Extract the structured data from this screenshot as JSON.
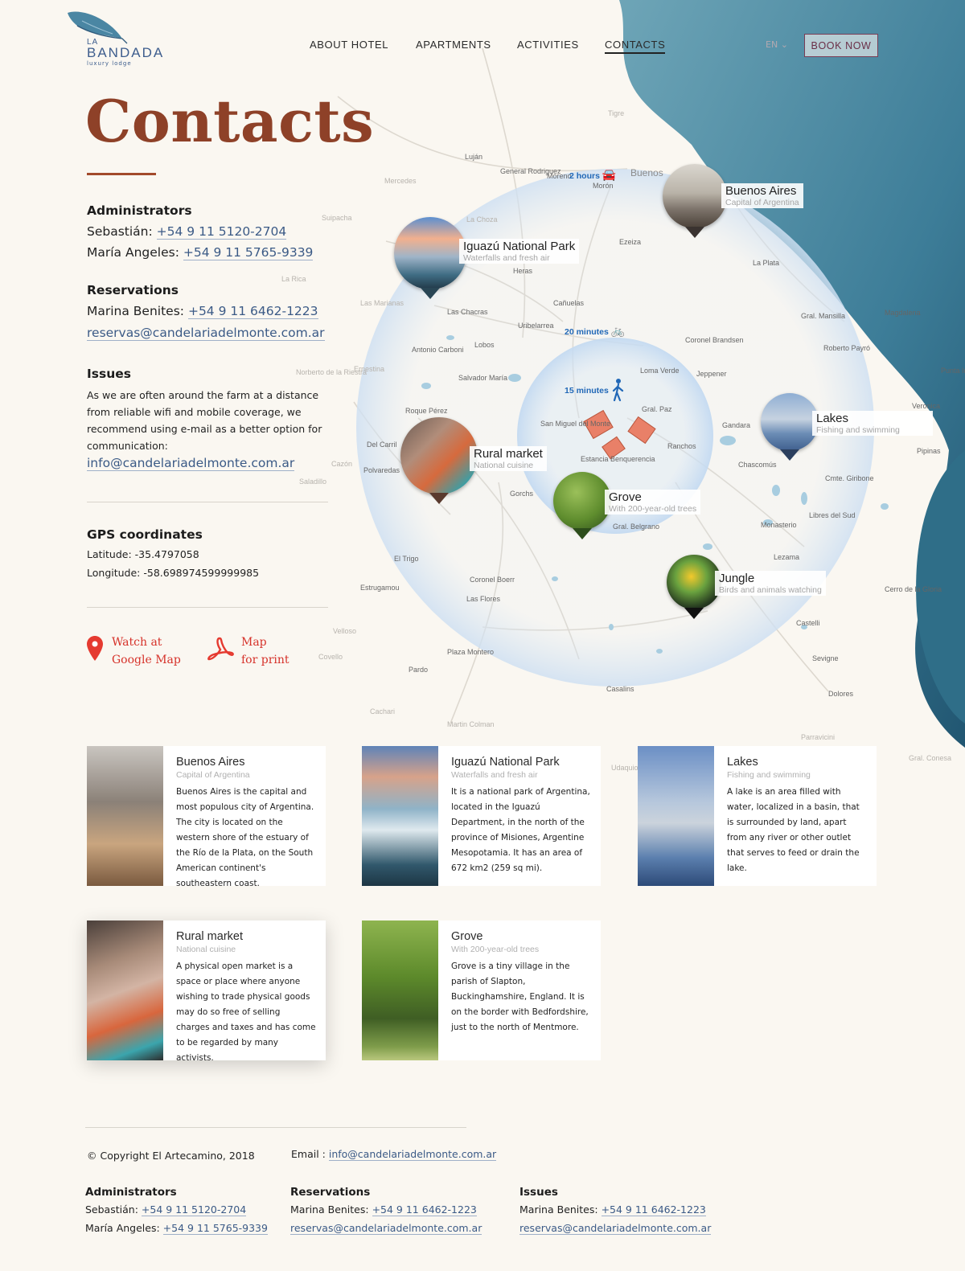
{
  "brand": {
    "name": "BANDADA",
    "prefix": "LA",
    "tagline": "luxury lodge"
  },
  "nav": {
    "items": [
      "ABOUT HOTEL",
      "APARTMENTS",
      "ACTIVITIES",
      "CONTACTS"
    ],
    "active": "CONTACTS",
    "lang": "EN",
    "book_label": "BOOK NOW"
  },
  "page": {
    "title": "Contacts"
  },
  "administrators": {
    "heading": "Administrators",
    "contacts": [
      {
        "name": "Sebastián:",
        "phone": "+54 9 11 5120-2704"
      },
      {
        "name": "María Angeles:",
        "phone": "+54 9 11 5765-9339"
      }
    ]
  },
  "reservations": {
    "heading": "Reservations",
    "name": "Marina Benites:",
    "phone": "+54 9 11 6462-1223",
    "email": "reservas@candelariadelmonte.com.ar"
  },
  "issues": {
    "heading": "Issues",
    "text": "As we are often around the farm at a distance from reliable wifi and mobile coverage, we recommend using e-mail as a better option for communication:",
    "email": "info@candelariadelmonte.com.ar"
  },
  "gps": {
    "heading": "GPS coordinates",
    "latitude_label": "Latitude:",
    "latitude": "-35.4797058",
    "longitude_label": "Longitude:",
    "longitude": "-58.698974599999985"
  },
  "links": {
    "google_line1": "Watch at",
    "google_line2": "Google Map",
    "print_line1": "Map",
    "print_line2": "for print"
  },
  "map": {
    "times": {
      "car": "2 hours",
      "bike": "20 minutes",
      "walk": "15 minutes"
    },
    "pins": [
      {
        "title": "Buenos Aires",
        "subtitle": "Capital of Argentina"
      },
      {
        "title": "Iguazú National Park",
        "subtitle": "Waterfalls and fresh air"
      },
      {
        "title": "Lakes",
        "subtitle": "Fishing and swimming"
      },
      {
        "title": "Rural market",
        "subtitle": "National cuisine"
      },
      {
        "title": "Grove",
        "subtitle": "With 200-year-old trees"
      },
      {
        "title": "Jungle",
        "subtitle": "Birds and animals watching"
      }
    ],
    "places": [
      "Luján",
      "General Rodriguez",
      "Moreno",
      "Buenos",
      "Morón",
      "Mercedes",
      "La Plata",
      "Lobos",
      "Cañuelas",
      "Uribelarrea",
      "Las Chacras",
      "Las Marianas",
      "Antonio Carboni",
      "Salvador María",
      "Roque Pérez",
      "Del Carril",
      "Polvaredas",
      "Gorchs",
      "Coronel Brandsen",
      "Jeppener",
      "Loma Verde",
      "Gral. Paz",
      "San Miguel del Monte",
      "Ranchos",
      "Estancia Benquerencia",
      "Gral. Belgrano",
      "Chascomús",
      "Gandara",
      "Cmte. Giribone",
      "Libres del Sud",
      "Monasterio",
      "Lezama",
      "Castelli",
      "Sevigne",
      "Dolores",
      "Coronel Boerr",
      "Las Flores",
      "El Trigo",
      "Estrugamou",
      "Plaza Montero",
      "Pardo",
      "Casalins",
      "Gral. Mansilla",
      "Magdalena",
      "Roberto Payró",
      "Veronica",
      "Pipinas",
      "Punta In",
      "Cerro de la Gloria",
      "Heras",
      "Ezeiza",
      "Parravicini",
      "Martin Colman",
      "Ernestina",
      "Cazón",
      "Saladillo",
      "Velloso",
      "Covello",
      "Cachari",
      "Norberto de la Riestra",
      "La Rica",
      "Suipacha",
      "La Choza",
      "Tigre",
      "Gral. Conesa",
      "Udaquiola"
    ]
  },
  "cards": [
    {
      "title": "Buenos Aires",
      "subtitle": "Capital of Argentina",
      "text": "Buenos Aires is the capital and most populous city of Argentina. The city is located on the western shore of the estuary of the Río de la Plata, on the South American continent's southeastern coast."
    },
    {
      "title": "Iguazú National Park",
      "subtitle": "Waterfalls and fresh air",
      "text": "It is a national park of Argentina, located in the Iguazú Department, in the north of the province of Misiones, Argentine Mesopotamia. It has an area of 672 km2 (259 sq mi)."
    },
    {
      "title": "Lakes",
      "subtitle": "Fishing and swimming",
      "text": "A lake is an area filled with water, localized in a basin, that is surrounded by land, apart from any river or other outlet that serves to feed or drain the lake."
    },
    {
      "title": "Rural market",
      "subtitle": "National cuisine",
      "text": "A physical open market is a space or place where anyone wishing to trade physical goods may do so free of selling charges and taxes and has come to be regarded by many activists."
    },
    {
      "title": "Grove",
      "subtitle": "With 200-year-old trees",
      "text": "Grove is a tiny village in the parish of Slapton, Buckinghamshire, England. It is on the border with Bedfordshire, just to the north of Mentmore."
    }
  ],
  "footer": {
    "copyright": "© Copyright El Artecamino, 2018",
    "email_label": "Email :",
    "email": "info@candelariadelmonte.com.ar",
    "administrators": {
      "heading": "Administrators",
      "contacts": [
        {
          "name": "Sebastián:",
          "phone": "+54 9 11 5120-2704"
        },
        {
          "name": "María Angeles:",
          "phone": "+54 9 11 5765-9339"
        }
      ]
    },
    "reservations": {
      "heading": "Reservations",
      "name": "Marina Benites:",
      "phone": "+54 9 11 6462-1223",
      "email": "reservas@candelariadelmonte.com.ar"
    },
    "issues": {
      "heading": "Issues",
      "name": "Marina Benites:",
      "phone": "+54 9 11 6462-1223",
      "email": "reservas@candelariadelmonte.com.ar"
    }
  },
  "colors": {
    "accent": "#8e4128",
    "link": "#3b5a86",
    "red": "#d6322a",
    "book": "#7a3d55",
    "sea": "#3d7d98",
    "route": "#2168b7"
  }
}
